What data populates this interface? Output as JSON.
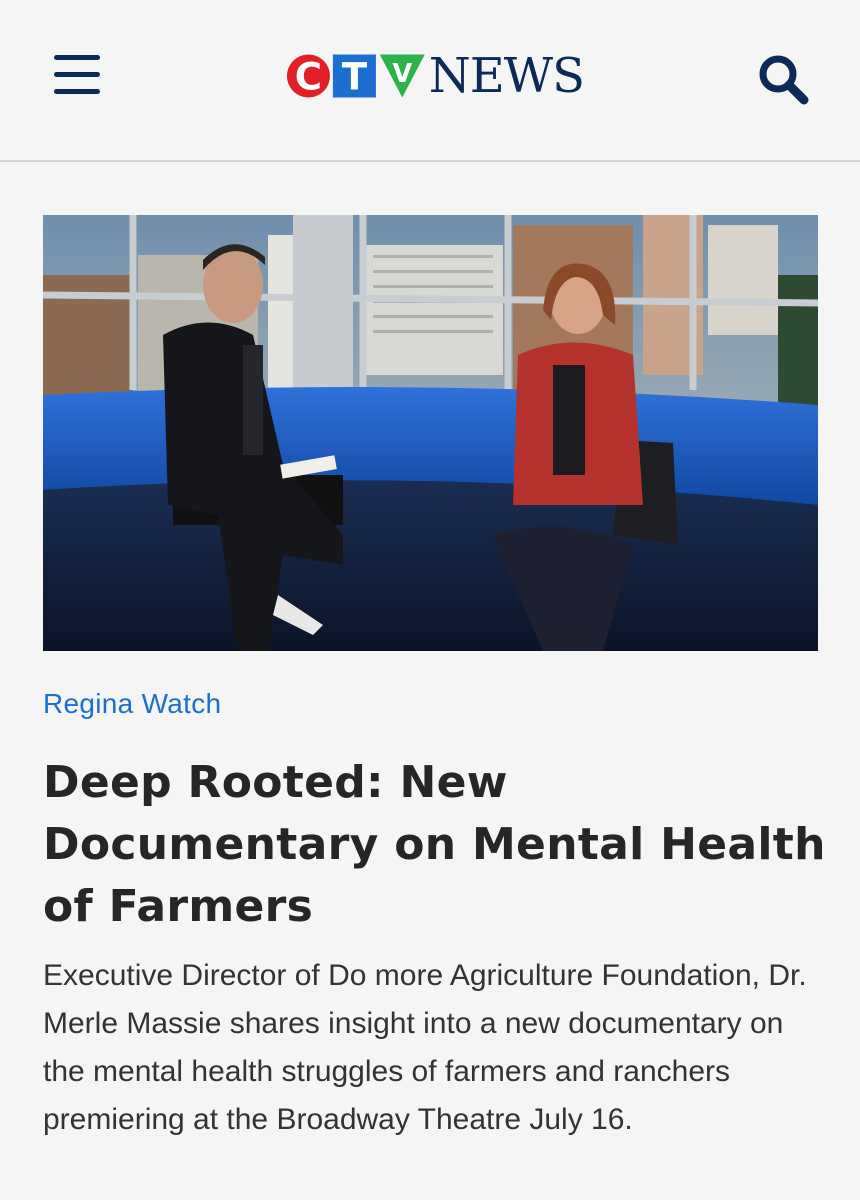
{
  "header": {
    "menu_icon": "hamburger-menu-icon",
    "logo": {
      "ctv": [
        "C",
        "T",
        "V"
      ],
      "word": "NEWS",
      "colors": [
        "#e21f26",
        "#1c6fd1",
        "#2eb34a"
      ]
    },
    "search_icon": "search-icon"
  },
  "video": {
    "description_icon": "video-thumbnail"
  },
  "article": {
    "category": "Regina Watch",
    "headline": "Deep Rooted: New Documentary on Mental Health of Farmers",
    "summary": "Executive Director of Do more Agriculture Foundation, Dr. Merle Massie shares insight into a new documentary on the mental health struggles of farmers and ranchers premiering at the Broadway Theatre July 16."
  },
  "colors": {
    "brand_navy": "#0c2a55",
    "link_blue": "#1c6fd1",
    "background": "#f5f5f5"
  }
}
